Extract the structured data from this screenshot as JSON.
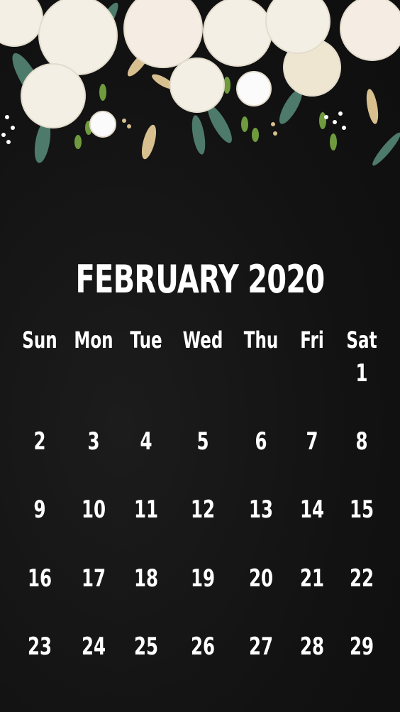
{
  "calendar": {
    "title": "FEBRUARY 2020",
    "weekdays": [
      "Sun",
      "Mon",
      "Tue",
      "Wed",
      "Thu",
      "Fri",
      "Sat"
    ],
    "weeks": [
      [
        "",
        "",
        "",
        "",
        "",
        "",
        "1"
      ],
      [
        "2",
        "3",
        "4",
        "5",
        "6",
        "7",
        "8"
      ],
      [
        "9",
        "10",
        "11",
        "12",
        "13",
        "14",
        "15"
      ],
      [
        "16",
        "17",
        "18",
        "19",
        "20",
        "21",
        "22"
      ],
      [
        "23",
        "24",
        "25",
        "26",
        "27",
        "28",
        "29"
      ]
    ]
  },
  "colors": {
    "background": "#141414",
    "text": "#ffffff",
    "flower": "#f3efe4",
    "leaf": "#4d7a6a",
    "gold": "#d8bf8f"
  }
}
